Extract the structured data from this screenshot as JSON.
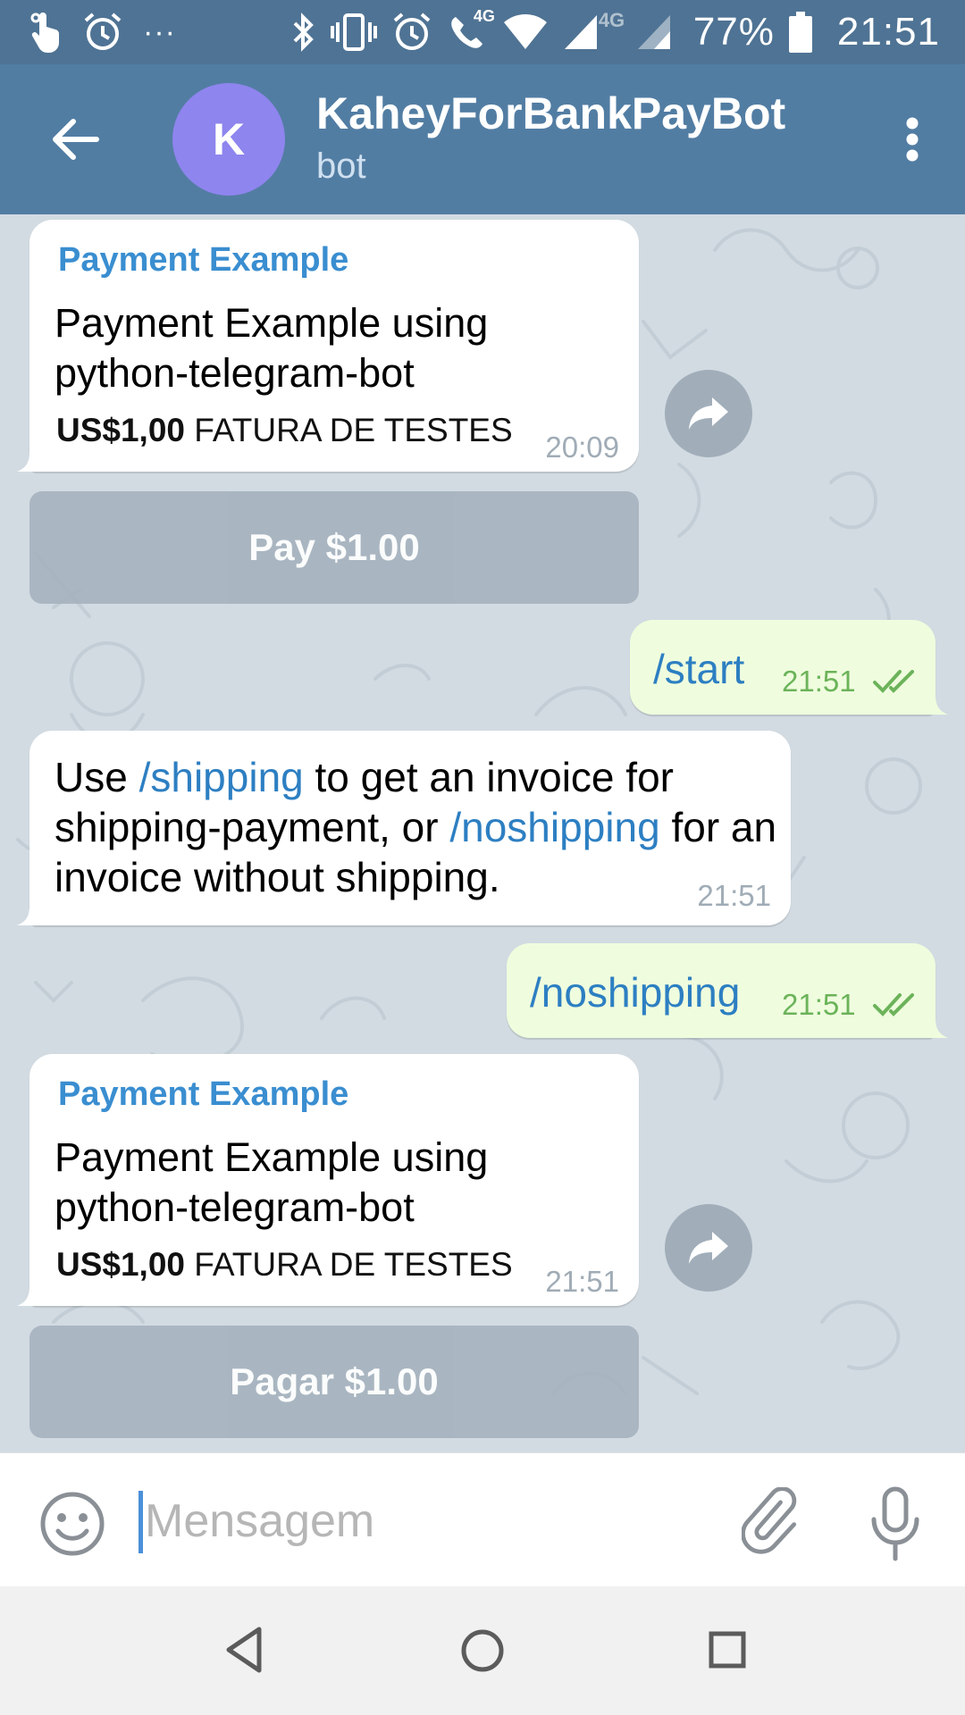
{
  "status_bar": {
    "more_indicator": "···",
    "net_label_1": "4G",
    "net_label_2": "4G",
    "battery": "77%",
    "time": "21:51",
    "icons": [
      "touch-icon",
      "alarm-icon",
      "bluetooth-icon",
      "vibrate-icon",
      "alarm-icon",
      "wifi-call-icon",
      "wifi-icon",
      "signal-icon",
      "signal-icon",
      "battery-icon"
    ]
  },
  "header": {
    "avatar_letter": "K",
    "title": "KaheyForBankPayBot",
    "subtitle": "bot",
    "colors": {
      "bar": "#527da3",
      "status_bar": "#4f7394",
      "avatar": "#8e85ee"
    }
  },
  "messages": [
    {
      "type": "invoice",
      "title": "Payment Example",
      "description": "Payment Example using python-telegram-bot",
      "amount": "US$1,00",
      "invoice_label": "FATURA DE TESTES",
      "time": "20:09",
      "button": "Pay $1.00"
    },
    {
      "type": "outgoing",
      "text": "/start",
      "time": "21:51"
    },
    {
      "type": "incoming",
      "parts": {
        "p1": "Use ",
        "link1": "/shipping",
        "p2": " to get an invoice for shipping-payment, or ",
        "link2": "/noshipping",
        "p3": " for an invoice without shipping."
      },
      "time": "21:51"
    },
    {
      "type": "outgoing",
      "text": "/noshipping",
      "time": "21:51"
    },
    {
      "type": "invoice",
      "title": "Payment Example",
      "description": "Payment Example using python-telegram-bot",
      "amount": "US$1,00",
      "invoice_label": "FATURA DE TESTES",
      "time": "21:51",
      "button": "Pagar $1.00"
    }
  ],
  "composer": {
    "placeholder": "Mensagem"
  },
  "colors": {
    "accent": "#3a8ed0",
    "outgoing_bubble": "#effdde",
    "chat_background": "#d2dbe2",
    "read_checks": "#6cb35a"
  }
}
